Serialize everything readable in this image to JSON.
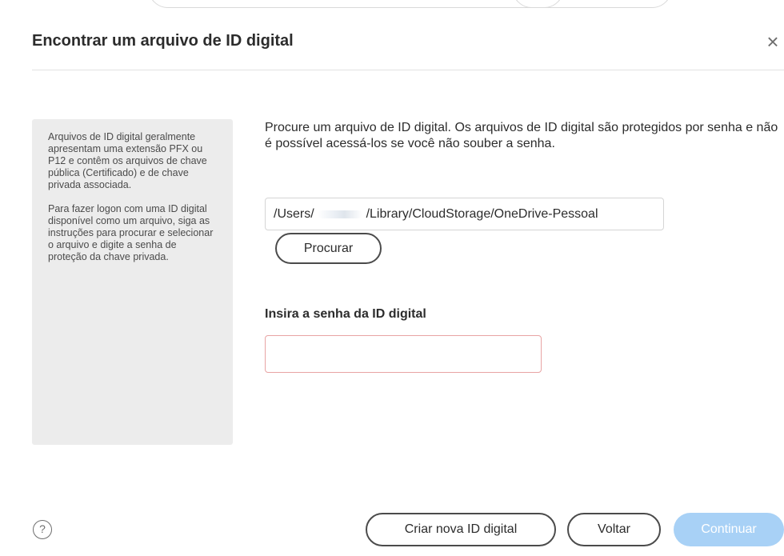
{
  "dialog": {
    "title": "Encontrar um arquivo de ID digital",
    "close_glyph": "×",
    "close_icon": "close-icon"
  },
  "info_panel": {
    "paragraphs": [
      "Arquivos de ID digital geralmente apresentam uma extensão PFX ou P12 e contêm os arquivos de chave pública (Certificado) e de chave privada associada.",
      "Para fazer logon com uma ID digital disponível como um arquivo, siga as instruções para procurar e selecionar o arquivo e digite a senha de proteção da chave privada."
    ]
  },
  "main": {
    "description": "Procure um arquivo de ID digital. Os arquivos de ID digital são protegidos por senha e não é possível acessá-los se você não souber a senha.",
    "path_value_prefix": "/Users/",
    "path_value_suffix": "/Library/CloudStorage/OneDrive-Pessoal",
    "browse_label": "Procurar",
    "password_label": "Insira a senha da ID digital",
    "password_value": ""
  },
  "footer": {
    "help_glyph": "?",
    "help_icon": "help-icon",
    "create_label": "Criar nova ID digital",
    "back_label": "Voltar",
    "continue_label": "Continuar"
  },
  "colors": {
    "continue_bg": "#a8d1f6",
    "password_border_error": "#e8a4a4",
    "info_panel_bg": "#ececec"
  }
}
